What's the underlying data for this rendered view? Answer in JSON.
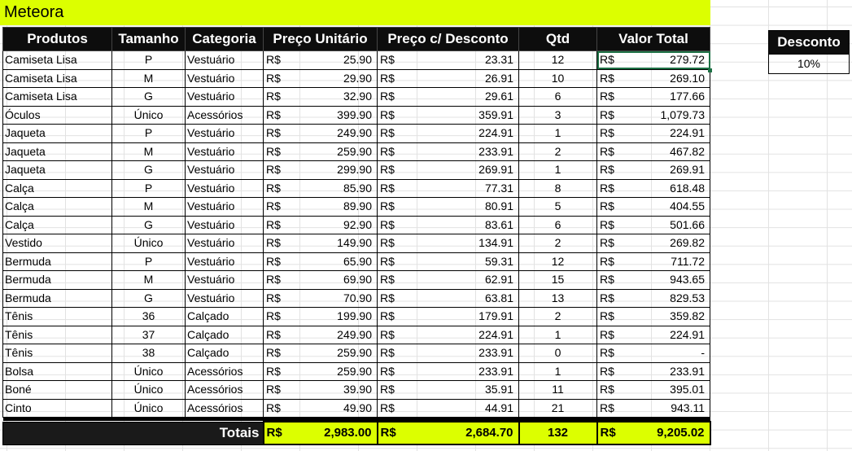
{
  "title": "Meteora",
  "headers": [
    "Produtos",
    "Tamanho",
    "Categoria",
    "Preço Unitário",
    "Preço c/ Desconto",
    "Qtd",
    "Valor Total"
  ],
  "currency": "R$",
  "rows": [
    {
      "produto": "Camiseta Lisa",
      "tamanho": "P",
      "categoria": "Vestuário",
      "preco": "25.90",
      "desconto": "23.31",
      "qtd": "12",
      "total": "279.72"
    },
    {
      "produto": "Camiseta Lisa",
      "tamanho": "M",
      "categoria": "Vestuário",
      "preco": "29.90",
      "desconto": "26.91",
      "qtd": "10",
      "total": "269.10"
    },
    {
      "produto": "Camiseta Lisa",
      "tamanho": "G",
      "categoria": "Vestuário",
      "preco": "32.90",
      "desconto": "29.61",
      "qtd": "6",
      "total": "177.66"
    },
    {
      "produto": "Óculos",
      "tamanho": "Único",
      "categoria": "Acessórios",
      "preco": "399.90",
      "desconto": "359.91",
      "qtd": "3",
      "total": "1,079.73"
    },
    {
      "produto": "Jaqueta",
      "tamanho": "P",
      "categoria": "Vestuário",
      "preco": "249.90",
      "desconto": "224.91",
      "qtd": "1",
      "total": "224.91"
    },
    {
      "produto": "Jaqueta",
      "tamanho": "M",
      "categoria": "Vestuário",
      "preco": "259.90",
      "desconto": "233.91",
      "qtd": "2",
      "total": "467.82"
    },
    {
      "produto": "Jaqueta",
      "tamanho": "G",
      "categoria": "Vestuário",
      "preco": "299.90",
      "desconto": "269.91",
      "qtd": "1",
      "total": "269.91"
    },
    {
      "produto": "Calça",
      "tamanho": "P",
      "categoria": "Vestuário",
      "preco": "85.90",
      "desconto": "77.31",
      "qtd": "8",
      "total": "618.48"
    },
    {
      "produto": "Calça",
      "tamanho": "M",
      "categoria": "Vestuário",
      "preco": "89.90",
      "desconto": "80.91",
      "qtd": "5",
      "total": "404.55"
    },
    {
      "produto": "Calça",
      "tamanho": "G",
      "categoria": "Vestuário",
      "preco": "92.90",
      "desconto": "83.61",
      "qtd": "6",
      "total": "501.66"
    },
    {
      "produto": "Vestido",
      "tamanho": "Único",
      "categoria": "Vestuário",
      "preco": "149.90",
      "desconto": "134.91",
      "qtd": "2",
      "total": "269.82"
    },
    {
      "produto": "Bermuda",
      "tamanho": "P",
      "categoria": "Vestuário",
      "preco": "65.90",
      "desconto": "59.31",
      "qtd": "12",
      "total": "711.72"
    },
    {
      "produto": "Bermuda",
      "tamanho": "M",
      "categoria": "Vestuário",
      "preco": "69.90",
      "desconto": "62.91",
      "qtd": "15",
      "total": "943.65"
    },
    {
      "produto": "Bermuda",
      "tamanho": "G",
      "categoria": "Vestuário",
      "preco": "70.90",
      "desconto": "63.81",
      "qtd": "13",
      "total": "829.53"
    },
    {
      "produto": "Tênis",
      "tamanho": "36",
      "categoria": "Calçado",
      "preco": "199.90",
      "desconto": "179.91",
      "qtd": "2",
      "total": "359.82"
    },
    {
      "produto": "Tênis",
      "tamanho": "37",
      "categoria": "Calçado",
      "preco": "249.90",
      "desconto": "224.91",
      "qtd": "1",
      "total": "224.91"
    },
    {
      "produto": "Tênis",
      "tamanho": "38",
      "categoria": "Calçado",
      "preco": "259.90",
      "desconto": "233.91",
      "qtd": "0",
      "total": "-"
    },
    {
      "produto": "Bolsa",
      "tamanho": "Único",
      "categoria": "Acessórios",
      "preco": "259.90",
      "desconto": "233.91",
      "qtd": "1",
      "total": "233.91"
    },
    {
      "produto": "Boné",
      "tamanho": "Único",
      "categoria": "Acessórios",
      "preco": "39.90",
      "desconto": "35.91",
      "qtd": "11",
      "total": "395.01"
    },
    {
      "produto": "Cinto",
      "tamanho": "Único",
      "categoria": "Acessórios",
      "preco": "49.90",
      "desconto": "44.91",
      "qtd": "21",
      "total": "943.11"
    }
  ],
  "totals": {
    "label": "Totais",
    "preco": "2,983.00",
    "desconto": "2,684.70",
    "qtd": "132",
    "total": "9,205.02"
  },
  "discount": {
    "header": "Desconto",
    "value": "10%"
  },
  "colors": {
    "accent": "#dcff00",
    "header_bg": "#0d0d0d",
    "selection": "#1e7145"
  }
}
